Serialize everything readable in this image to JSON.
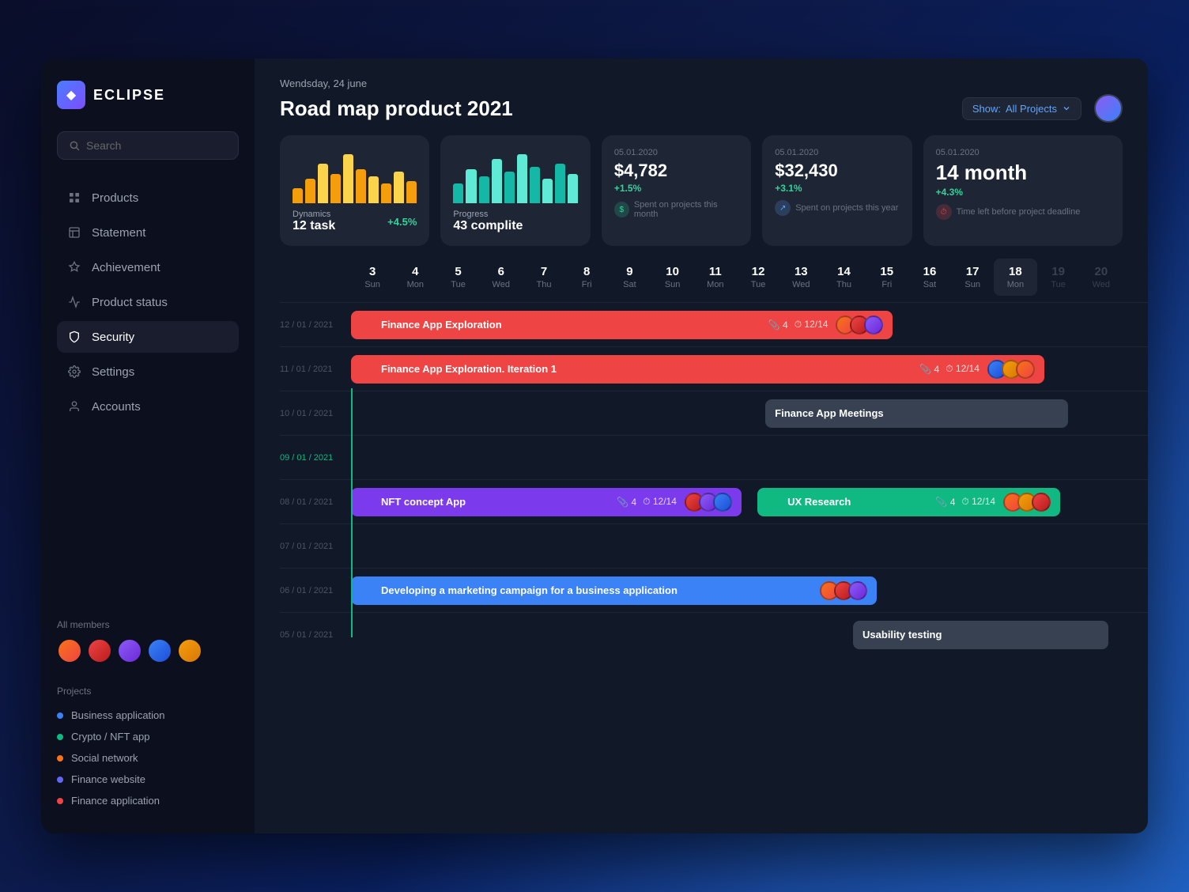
{
  "app": {
    "name": "ECLIPSE",
    "logo_symbol": "◆"
  },
  "search": {
    "placeholder": "Search"
  },
  "nav": {
    "items": [
      {
        "id": "products",
        "label": "Products",
        "icon": "grid-icon"
      },
      {
        "id": "statement",
        "label": "Statement",
        "icon": "statement-icon"
      },
      {
        "id": "achievement",
        "label": "Achievement",
        "icon": "achievement-icon"
      },
      {
        "id": "product-status",
        "label": "Product status",
        "icon": "product-status-icon"
      },
      {
        "id": "security",
        "label": "Security",
        "icon": "security-icon",
        "active": true
      },
      {
        "id": "settings",
        "label": "Settings",
        "icon": "settings-icon"
      },
      {
        "id": "accounts",
        "label": "Accounts",
        "icon": "accounts-icon"
      }
    ]
  },
  "members": {
    "title": "All members",
    "avatars": [
      "a1",
      "a2",
      "a3",
      "a4",
      "a5"
    ]
  },
  "projects": {
    "title": "Projects",
    "items": [
      {
        "label": "Business application",
        "color": "#3b82f6"
      },
      {
        "label": "Crypto / NFT app",
        "color": "#10b981"
      },
      {
        "label": "Social network",
        "color": "#f97316"
      },
      {
        "label": "Finance website",
        "color": "#6366f1"
      },
      {
        "label": "Finance application",
        "color": "#ef4444"
      }
    ]
  },
  "header": {
    "date": "Wendsday, 24 june",
    "title": "Road map product 2021",
    "show_label": "Show:",
    "filter": "All Projects"
  },
  "stats": [
    {
      "id": "dynamics",
      "type": "chart",
      "chart_type": "bar_yellow",
      "label": "Dynamics",
      "sub_label": "12 task",
      "change": "+4.5%"
    },
    {
      "id": "progress",
      "type": "chart",
      "chart_type": "bar_teal",
      "label": "Progress",
      "sub_label": "43 complite"
    },
    {
      "id": "spent_month",
      "type": "number",
      "date": "05.01.2020",
      "value": "$4,782",
      "change": "+1.5%",
      "desc": "Spent on projects this month",
      "icon_type": "green"
    },
    {
      "id": "spent_year",
      "type": "number",
      "date": "05.01.2020",
      "value": "$32,430",
      "change": "+3.1%",
      "desc": "Spent on projects this year",
      "icon_type": "blue"
    },
    {
      "id": "time_left",
      "type": "number",
      "date": "05.01.2020",
      "value": "14 month",
      "change": "+4.3%",
      "desc": "Time left before project deadline",
      "icon_type": "red"
    }
  ],
  "calendar": {
    "days": [
      {
        "num": "3",
        "name": "Sun"
      },
      {
        "num": "4",
        "name": "Mon"
      },
      {
        "num": "5",
        "name": "Tue"
      },
      {
        "num": "6",
        "name": "Wed"
      },
      {
        "num": "7",
        "name": "Thu"
      },
      {
        "num": "8",
        "name": "Fri"
      },
      {
        "num": "9",
        "name": "Sat"
      },
      {
        "num": "10",
        "name": "Sun"
      },
      {
        "num": "11",
        "name": "Mon"
      },
      {
        "num": "12",
        "name": "Tue"
      },
      {
        "num": "13",
        "name": "Wed"
      },
      {
        "num": "14",
        "name": "Thu"
      },
      {
        "num": "15",
        "name": "Fri"
      },
      {
        "num": "16",
        "name": "Sat"
      },
      {
        "num": "17",
        "name": "Sun"
      },
      {
        "num": "18",
        "name": "Mon",
        "today": true
      },
      {
        "num": "19",
        "name": "Tue",
        "dimmed": true
      },
      {
        "num": "20",
        "name": "Wed",
        "dimmed": true
      }
    ]
  },
  "gantt": {
    "rows": [
      {
        "date": "12 / 01 / 2021",
        "bar": {
          "label": "Finance App Exploration",
          "color": "red",
          "left": "0%",
          "width": "68%",
          "attachments": "4",
          "progress": "12/14",
          "avatars": [
            "av1",
            "av2",
            "av3"
          ]
        }
      },
      {
        "date": "11 / 01 / 2021",
        "bar": {
          "label": "Finance App Exploration. Iteration 1",
          "color": "red",
          "left": "0%",
          "width": "87%",
          "attachments": "4",
          "progress": "12/14",
          "avatars": [
            "av4",
            "av5",
            "av1"
          ]
        }
      },
      {
        "date": "10 / 01 / 2021",
        "bar": {
          "label": "Finance App Meetings",
          "color": "gray",
          "left": "52%",
          "width": "38%",
          "attachments": null,
          "progress": null
        }
      },
      {
        "date": "09 / 01 / 2021",
        "is_today_line": true
      },
      {
        "date": "08 / 01 / 2021",
        "bar2": [
          {
            "label": "NFT concept App",
            "color": "purple",
            "left": "0%",
            "width": "50%",
            "attachments": "4",
            "progress": "12/14",
            "avatars": [
              "av2",
              "av3",
              "av4"
            ]
          },
          {
            "label": "UX Research",
            "color": "teal",
            "left": "52%",
            "width": "38%",
            "attachments": "4",
            "progress": "12/14",
            "avatars": [
              "av1",
              "av5",
              "av2"
            ]
          }
        ]
      },
      {
        "date": "07 / 01 / 2021",
        "bar": null
      },
      {
        "date": "06 / 01 / 2021",
        "bar": {
          "label": "Developing a marketing campaign for a business application",
          "color": "blue",
          "left": "0%",
          "width": "66%",
          "attachments": null,
          "progress": null,
          "avatars": [
            "av1",
            "av2",
            "av3"
          ]
        }
      },
      {
        "date": "05 / 01 / 2021",
        "bar": {
          "label": "Usability testing",
          "color": "gray",
          "left": "63%",
          "width": "32%",
          "attachments": null,
          "progress": null
        }
      }
    ]
  }
}
